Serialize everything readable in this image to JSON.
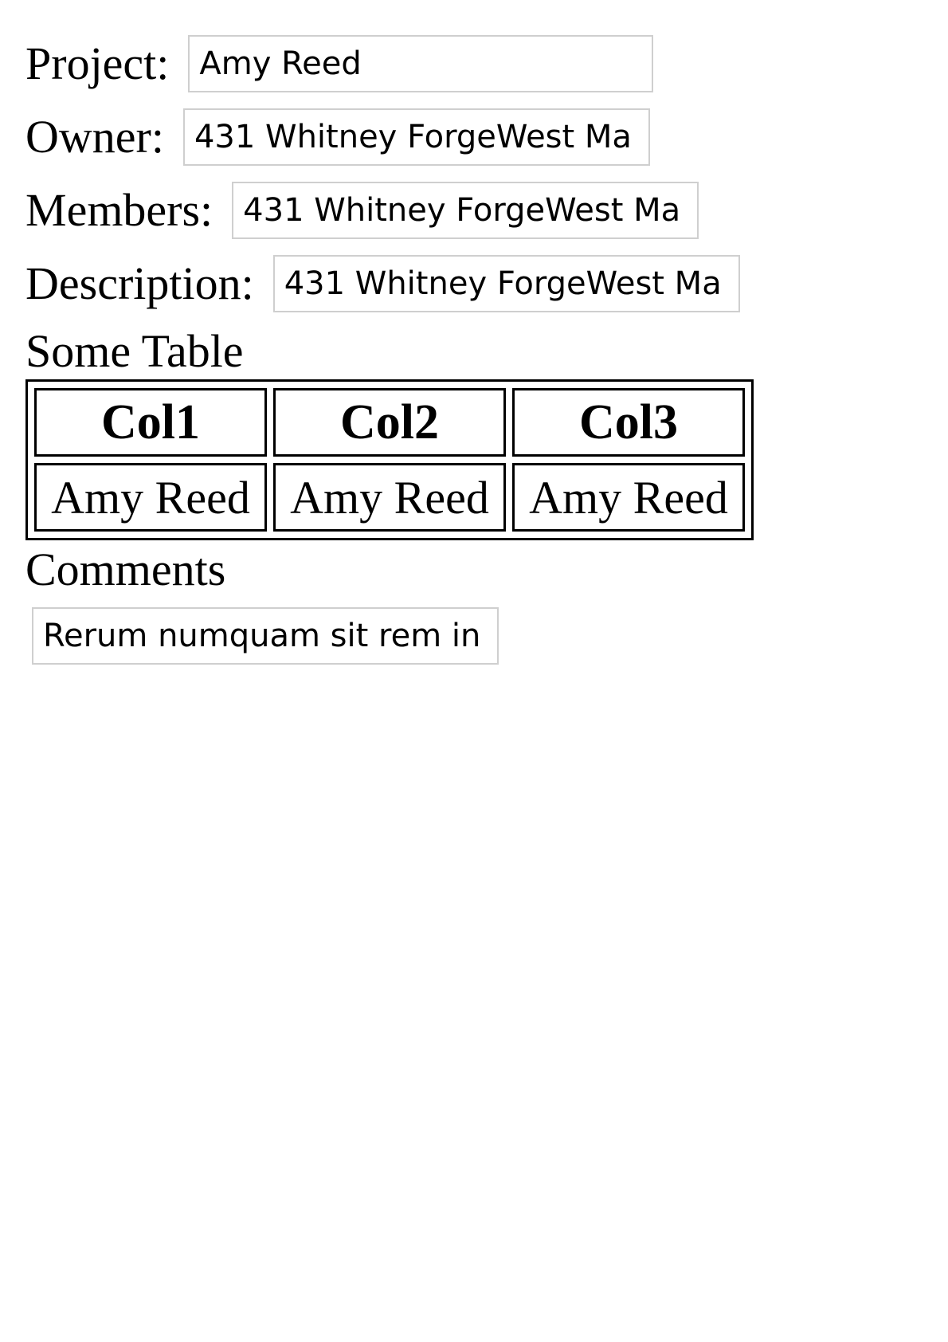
{
  "form": {
    "project": {
      "label": "Project:",
      "value": "Amy Reed"
    },
    "owner": {
      "label": "Owner:",
      "value": "431 Whitney ForgeWest Ma"
    },
    "members": {
      "label": "Members:",
      "value": "431 Whitney ForgeWest Ma"
    },
    "description": {
      "label": "Description:",
      "value": "431 Whitney ForgeWest Ma"
    }
  },
  "table": {
    "heading": "Some Table",
    "columns": [
      "Col1",
      "Col2",
      "Col3"
    ],
    "rows": [
      [
        "Amy Reed",
        "Amy Reed",
        "Amy Reed"
      ]
    ]
  },
  "comments": {
    "heading": "Comments",
    "value": "Rerum numquam sit rem in"
  }
}
